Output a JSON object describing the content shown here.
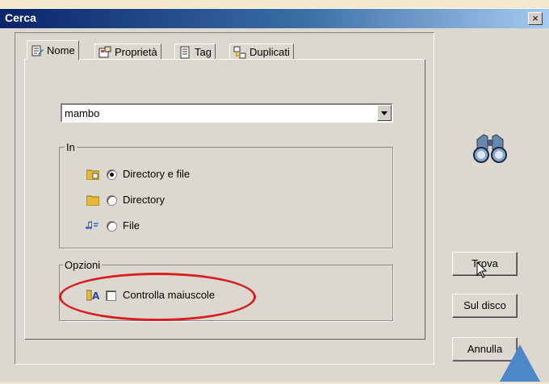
{
  "window": {
    "title": "Cerca",
    "close_label": "×"
  },
  "tabs": [
    {
      "label": "Nome",
      "icon": "document-edit-icon",
      "active": true
    },
    {
      "label": "Proprietà",
      "icon": "properties-icon",
      "active": false
    },
    {
      "label": "Tag",
      "icon": "tag-document-icon",
      "active": false
    },
    {
      "label": "Duplicati",
      "icon": "duplicates-icon",
      "active": false
    }
  ],
  "search": {
    "value": "mambo"
  },
  "in_group": {
    "label": "In",
    "options": [
      {
        "label": "Directory e file",
        "icon": "folder-file-icon",
        "checked": true
      },
      {
        "label": "Directory",
        "icon": "folder-icon",
        "checked": false
      },
      {
        "label": "File",
        "icon": "music-file-icon",
        "checked": false
      }
    ]
  },
  "options_group": {
    "label": "Opzioni",
    "case_label": "Controlla maiuscole",
    "case_checked": false,
    "case_icon": "case-sensitive-icon"
  },
  "buttons": {
    "find": "Trova",
    "on_disk": "Sul disco",
    "cancel": "Annulla"
  },
  "colors": {
    "accent_annotation": "#d62020",
    "title_bar": "#0a246a",
    "triangle": "#4f88c8"
  }
}
